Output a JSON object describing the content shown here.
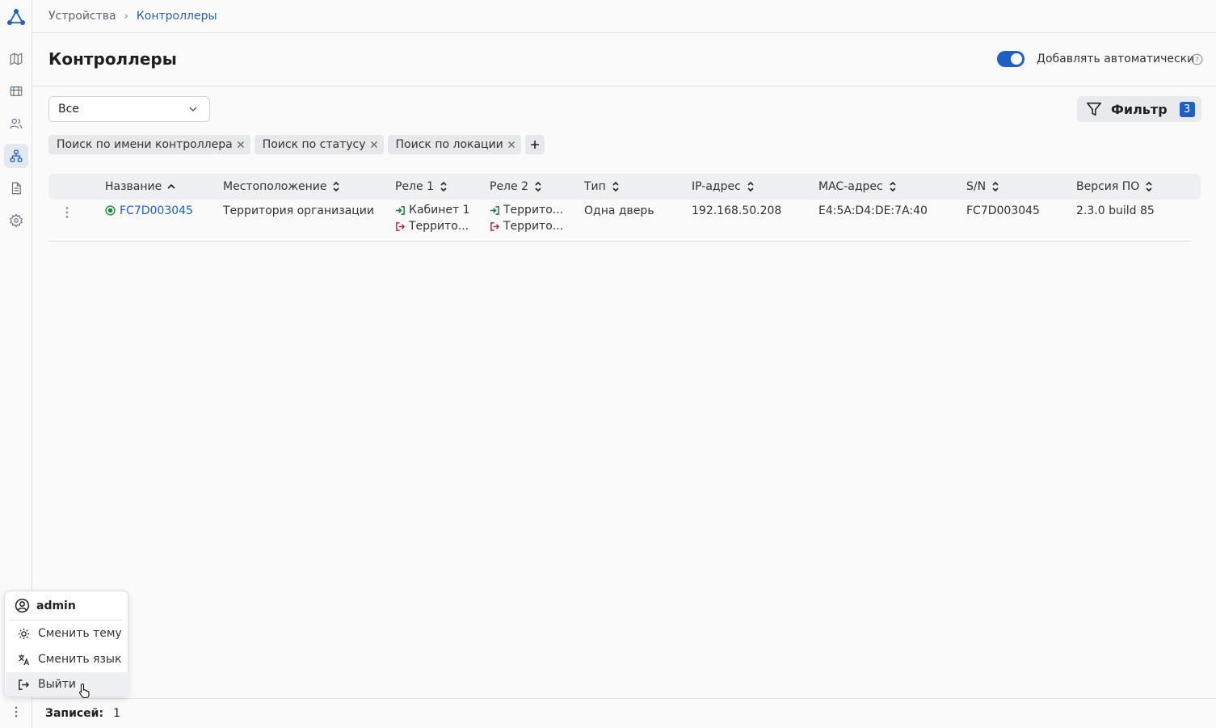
{
  "breadcrumb": {
    "parent": "Устройства",
    "current": "Контроллеры"
  },
  "page": {
    "title": "Контроллеры"
  },
  "auto_add": {
    "label": "Добавлять автоматически",
    "enabled": true
  },
  "status_select": {
    "value": "Все"
  },
  "filter_button": {
    "label": "Фильтр",
    "count": "3"
  },
  "chips": [
    {
      "label": "Поиск по имени контроллера"
    },
    {
      "label": "Поиск по статусу"
    },
    {
      "label": "Поиск по локации"
    }
  ],
  "table": {
    "columns": [
      "Название",
      "Местоположение",
      "Реле 1",
      "Реле 2",
      "Тип",
      "IP-адрес",
      "MAC-адрес",
      "S/N",
      "Версия ПО"
    ],
    "rows": [
      {
        "name": "FC7D003045",
        "location": "Территория организации",
        "relay1_in": "Кабинет 1",
        "relay1_out": "Террито...",
        "relay2_in": "Террито...",
        "relay2_out": "Террито...",
        "type": "Одна дверь",
        "ip": "192.168.50.208",
        "mac": "E4:5A:D4:DE:7A:40",
        "sn": "FC7D003045",
        "version": "2.3.0 build 85"
      }
    ]
  },
  "user_menu": {
    "user": "admin",
    "items": [
      "Сменить тему",
      "Сменить язык",
      "Выйти"
    ]
  },
  "footer": {
    "records_label": "Записей:",
    "records_count": "1"
  },
  "colors": {
    "accent": "#1f5fc4",
    "status_ok": "#1a8a3a",
    "enter": "#1a7a3a",
    "exit": "#b22a4a"
  },
  "sidebar": {
    "items": [
      "map-icon",
      "devices-icon",
      "users-icon",
      "controllers-icon",
      "reports-icon",
      "settings-icon"
    ]
  }
}
